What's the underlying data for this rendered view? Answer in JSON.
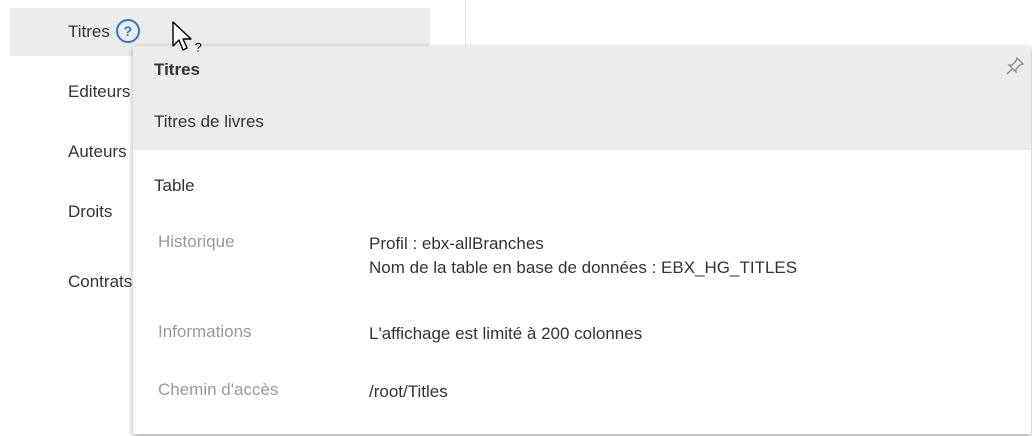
{
  "nav": {
    "items": [
      {
        "label": "Titres"
      },
      {
        "label": "Editeurs"
      },
      {
        "label": "Auteurs"
      },
      {
        "label": "Droits"
      },
      {
        "label": "Contrats"
      }
    ],
    "help_icon": "question-circle-icon"
  },
  "popup": {
    "title": "Titres",
    "description": "Titres de livres",
    "type": "Table",
    "pin_icon": "pin-icon",
    "properties": [
      {
        "label": "Historique",
        "value_lines": [
          "Profil : ebx-allBranches",
          "Nom de la table en base de données : EBX_HG_TITLES"
        ]
      },
      {
        "label": "Informations",
        "value_lines": [
          "L'affichage est limité à 200 colonnes"
        ]
      },
      {
        "label": "Chemin d'accès",
        "value_lines": [
          "/root/Titles"
        ]
      }
    ]
  },
  "colors": {
    "accent": "#2c78c5",
    "header_bg": "#ececec",
    "label_gray": "#999999"
  },
  "cursor_icon": "mouse-pointer-help-icon"
}
